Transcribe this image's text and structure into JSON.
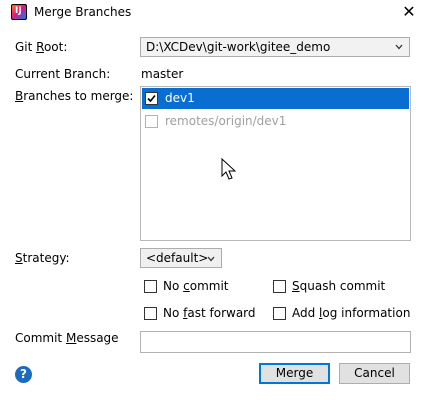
{
  "window": {
    "title": "Merge Branches",
    "close_glyph": "✕"
  },
  "app_icon_letter": "IJ",
  "git_root": {
    "label": "Git Root:",
    "value": "D:\\XCDev\\git-work\\gitee_demo"
  },
  "current_branch": {
    "label": "Current Branch:",
    "value": "master"
  },
  "branches": {
    "label": "Branches to merge:",
    "items": [
      {
        "name": "dev1",
        "checked": true,
        "selected": true,
        "enabled": true
      },
      {
        "name": "remotes/origin/dev1",
        "checked": false,
        "selected": false,
        "enabled": false
      }
    ]
  },
  "strategy": {
    "label": "Strategy:",
    "value": "<default>"
  },
  "options": {
    "no_commit": "No commit",
    "squash_commit": "Squash commit",
    "no_fast_forward": "No fast forward",
    "add_log_information": "Add log information"
  },
  "commit_message": {
    "label": "Commit Message",
    "value": ""
  },
  "buttons": {
    "help": "?",
    "merge": "Merge",
    "cancel": "Cancel"
  },
  "colors": {
    "selection": "#0a6ed1",
    "help": "#1c6bbf",
    "default_button_border": "#0078d7"
  },
  "icons": [
    "intellij-logo-icon",
    "close-icon",
    "chevron-down-icon",
    "checkbox-icon",
    "help-icon",
    "mouse-cursor-icon"
  ]
}
